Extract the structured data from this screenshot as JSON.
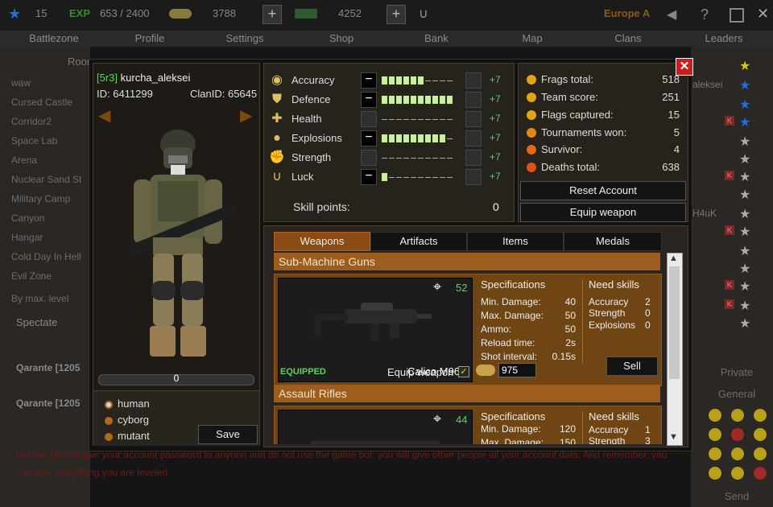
{
  "topbar": {
    "level": "15",
    "xp_label": "EXP",
    "xp": "653 / 2400",
    "coins": "3788",
    "cash": "4252",
    "server": "Europe A",
    "help": "?"
  },
  "nav": [
    "Battlezone",
    "Profile",
    "Settings",
    "Shop",
    "Bank",
    "Map",
    "Clans",
    "Leaders"
  ],
  "background": {
    "room_tab": "Room",
    "maps": [
      "waw",
      "Cursed Castle",
      "Corridor2",
      "Space Lab",
      "Arena",
      "Nuclear Sand St",
      "Military Camp",
      "Canyon",
      "Hangar",
      "Cold Day In Hell",
      "Evil Zone"
    ],
    "sort_label": "By max. level",
    "spectate": "Spectate",
    "players": [
      "Qarante [1205",
      "Qarante [1205"
    ],
    "right_names": [
      "aleksei",
      "H4uK"
    ],
    "right_private": "Private",
    "right_general": "General",
    "right_send": "Send",
    "chat_line1": "[admin] Do not give your account password to anyone and do not use the game bot, you will give other people all your account data. And remember, you",
    "chat_line2": "can lose everything you are leveled"
  },
  "profile": {
    "tag": "[5r3]",
    "name": "kurcha_aleksei",
    "id_text": "ID: 6411299",
    "clan_text": "ClanID: 65645",
    "progress": "0",
    "races": [
      {
        "label": "human",
        "selected": true
      },
      {
        "label": "cyborg",
        "selected": false
      },
      {
        "label": "mutant",
        "selected": false
      }
    ],
    "save_label": "Save"
  },
  "skills": {
    "items": [
      {
        "name": "Accuracy",
        "icon": "eye-icon",
        "filled": 6,
        "total": 10,
        "bonus": "+7"
      },
      {
        "name": "Defence",
        "icon": "shield-icon",
        "filled": 10,
        "total": 10,
        "bonus": "+7"
      },
      {
        "name": "Health",
        "icon": "cross-icon",
        "filled": 0,
        "total": 10,
        "bonus": "+7"
      },
      {
        "name": "Explosions",
        "icon": "grenade-icon",
        "filled": 9,
        "total": 10,
        "bonus": "+7"
      },
      {
        "name": "Strength",
        "icon": "fist-icon",
        "filled": 0,
        "total": 10,
        "bonus": "+7"
      },
      {
        "name": "Luck",
        "icon": "horseshoe-icon",
        "filled": 1,
        "total": 10,
        "bonus": "+7"
      }
    ],
    "points_label": "Skill points:",
    "points": "0"
  },
  "scores": {
    "items": [
      {
        "label": "Frags total:",
        "value": "518"
      },
      {
        "label": "Team score:",
        "value": "251"
      },
      {
        "label": "Flags captured:",
        "value": "15"
      },
      {
        "label": "Tournaments won:",
        "value": "5"
      },
      {
        "label": "Survivor:",
        "value": "4"
      },
      {
        "label": "Deaths total:",
        "value": "638"
      }
    ],
    "reset_label": "Reset Account",
    "equip_label": "Equip weapon"
  },
  "inventory": {
    "tabs": [
      "Weapons",
      "Artifacts",
      "Items",
      "Medals"
    ],
    "categories": [
      {
        "title": "Sub-Machine Guns",
        "rating": "52",
        "status": "EQUIPPED",
        "weapon": "Calico M960",
        "spec_title": "Specifications",
        "specs": [
          {
            "label": "Min. Damage:",
            "value": "40"
          },
          {
            "label": "Max. Damage:",
            "value": "50"
          },
          {
            "label": "Ammo:",
            "value": "50"
          },
          {
            "label": "Reload time:",
            "value": "2s"
          },
          {
            "label": "Shot interval:",
            "value": "0.15s"
          }
        ],
        "need_title": "Need skills",
        "needs": [
          {
            "label": "Accuracy",
            "value": "2"
          },
          {
            "label": "Strength",
            "value": "0"
          },
          {
            "label": "Explosions",
            "value": "0"
          }
        ],
        "equip_label": "Equip weapon",
        "check": "✓",
        "price": "975",
        "sell_label": "Sell"
      },
      {
        "title": "Assault Rifles",
        "rating": "44",
        "spec_title": "Specifications",
        "specs": [
          {
            "label": "Min. Damage:",
            "value": "120"
          },
          {
            "label": "Max. Damage:",
            "value": "150"
          }
        ],
        "need_title": "Need skills",
        "needs": [
          {
            "label": "Accuracy",
            "value": "1"
          },
          {
            "label": "Strength",
            "value": "3"
          }
        ]
      }
    ]
  },
  "colors": {
    "accent": "#9d5d1f",
    "bonus": "#5cd35c",
    "close": "#c81e1e"
  }
}
